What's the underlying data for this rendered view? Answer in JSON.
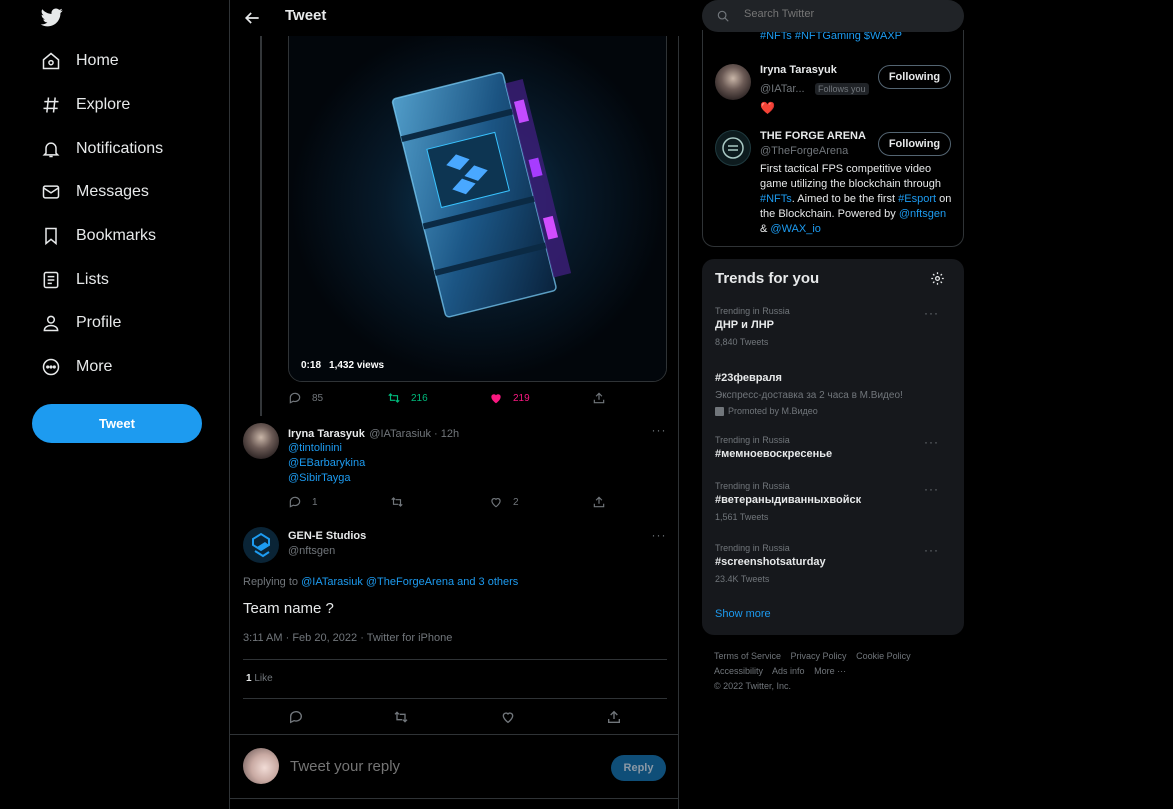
{
  "nav": {
    "items": [
      {
        "label": "Home",
        "icon": "home-icon"
      },
      {
        "label": "Explore",
        "icon": "hashtag-icon"
      },
      {
        "label": "Notifications",
        "icon": "bell-icon"
      },
      {
        "label": "Messages",
        "icon": "envelope-icon"
      },
      {
        "label": "Bookmarks",
        "icon": "bookmark-icon"
      },
      {
        "label": "Lists",
        "icon": "list-icon"
      },
      {
        "label": "Profile",
        "icon": "person-icon"
      },
      {
        "label": "More",
        "icon": "more-circle-icon"
      }
    ],
    "tweet_button": "Tweet"
  },
  "header": {
    "title": "Tweet"
  },
  "media": {
    "duration": "0:18",
    "views": "1,432 views"
  },
  "parent_actions": {
    "replies": "85",
    "retweets": "216",
    "likes": "219"
  },
  "reply1": {
    "name": "Iryna Tarasyuk",
    "handle": "@IATarasiuk · 12h",
    "mentions": [
      "@tintolinini",
      "@EBarbarykina",
      "@SibirTayga"
    ],
    "replies": "1",
    "retweets": "",
    "likes": "2"
  },
  "main_tweet": {
    "name": "GEN-E Studios",
    "handle": "@nftsgen",
    "replying_prefix": "Replying to",
    "replying_targets": "@IATarasiuk @TheForgeArena and 3 others",
    "text": "Team name ?",
    "timestamp": "3:11 AM · Feb 20, 2022 · Twitter for iPhone",
    "likes_count": "1",
    "likes_label": "Like"
  },
  "reply_box": {
    "placeholder": "Tweet your reply",
    "button": "Reply"
  },
  "search": {
    "placeholder": "Search Twitter"
  },
  "who_to_follow": {
    "top_text": "#NFTs #NFTGaming $WAXP",
    "users": [
      {
        "name": "Iryna Tarasyuk",
        "handle": "@IATar...",
        "badge": "Follows you",
        "bio": "❤️",
        "button": "Following"
      },
      {
        "name": "THE FORGE ARENA",
        "handle": "@TheForgeArena",
        "button": "Following",
        "bio_parts": [
          "First tactical FPS competitive video game utilizing the blockchain through ",
          "#NFTs",
          ". Aimed to be the first ",
          "#Esport",
          " on the Blockchain. Powered by ",
          "@nftsgen",
          " & ",
          "@WAX_io"
        ]
      }
    ]
  },
  "trends": {
    "title": "Trends for you",
    "items": [
      {
        "category": "Trending in Russia",
        "name": "ДНР и ЛНР",
        "count": "8,840 Tweets"
      },
      {
        "category": "",
        "name": "#23февраля",
        "desc": "Экспресс-доставка за 2 часа в М.Видео!",
        "promo": "Promoted by М.Видео"
      },
      {
        "category": "Trending in Russia",
        "name": "#мемноевоскресенье",
        "count": ""
      },
      {
        "category": "Trending in Russia",
        "name": "#ветераныдиванныхвойск",
        "count": "1,561 Tweets"
      },
      {
        "category": "Trending in Russia",
        "name": "#screenshotsaturday",
        "count": "23.4K Tweets"
      }
    ],
    "show_more": "Show more"
  },
  "footer": {
    "links": [
      "Terms of Service",
      "Privacy Policy",
      "Cookie Policy",
      "Accessibility",
      "Ads info",
      "More ···"
    ],
    "copyright": "© 2022 Twitter, Inc."
  },
  "colors": {
    "accent": "#1d9bf0",
    "like": "#f91880",
    "retweet": "#00ba7c",
    "background": "#000000"
  }
}
